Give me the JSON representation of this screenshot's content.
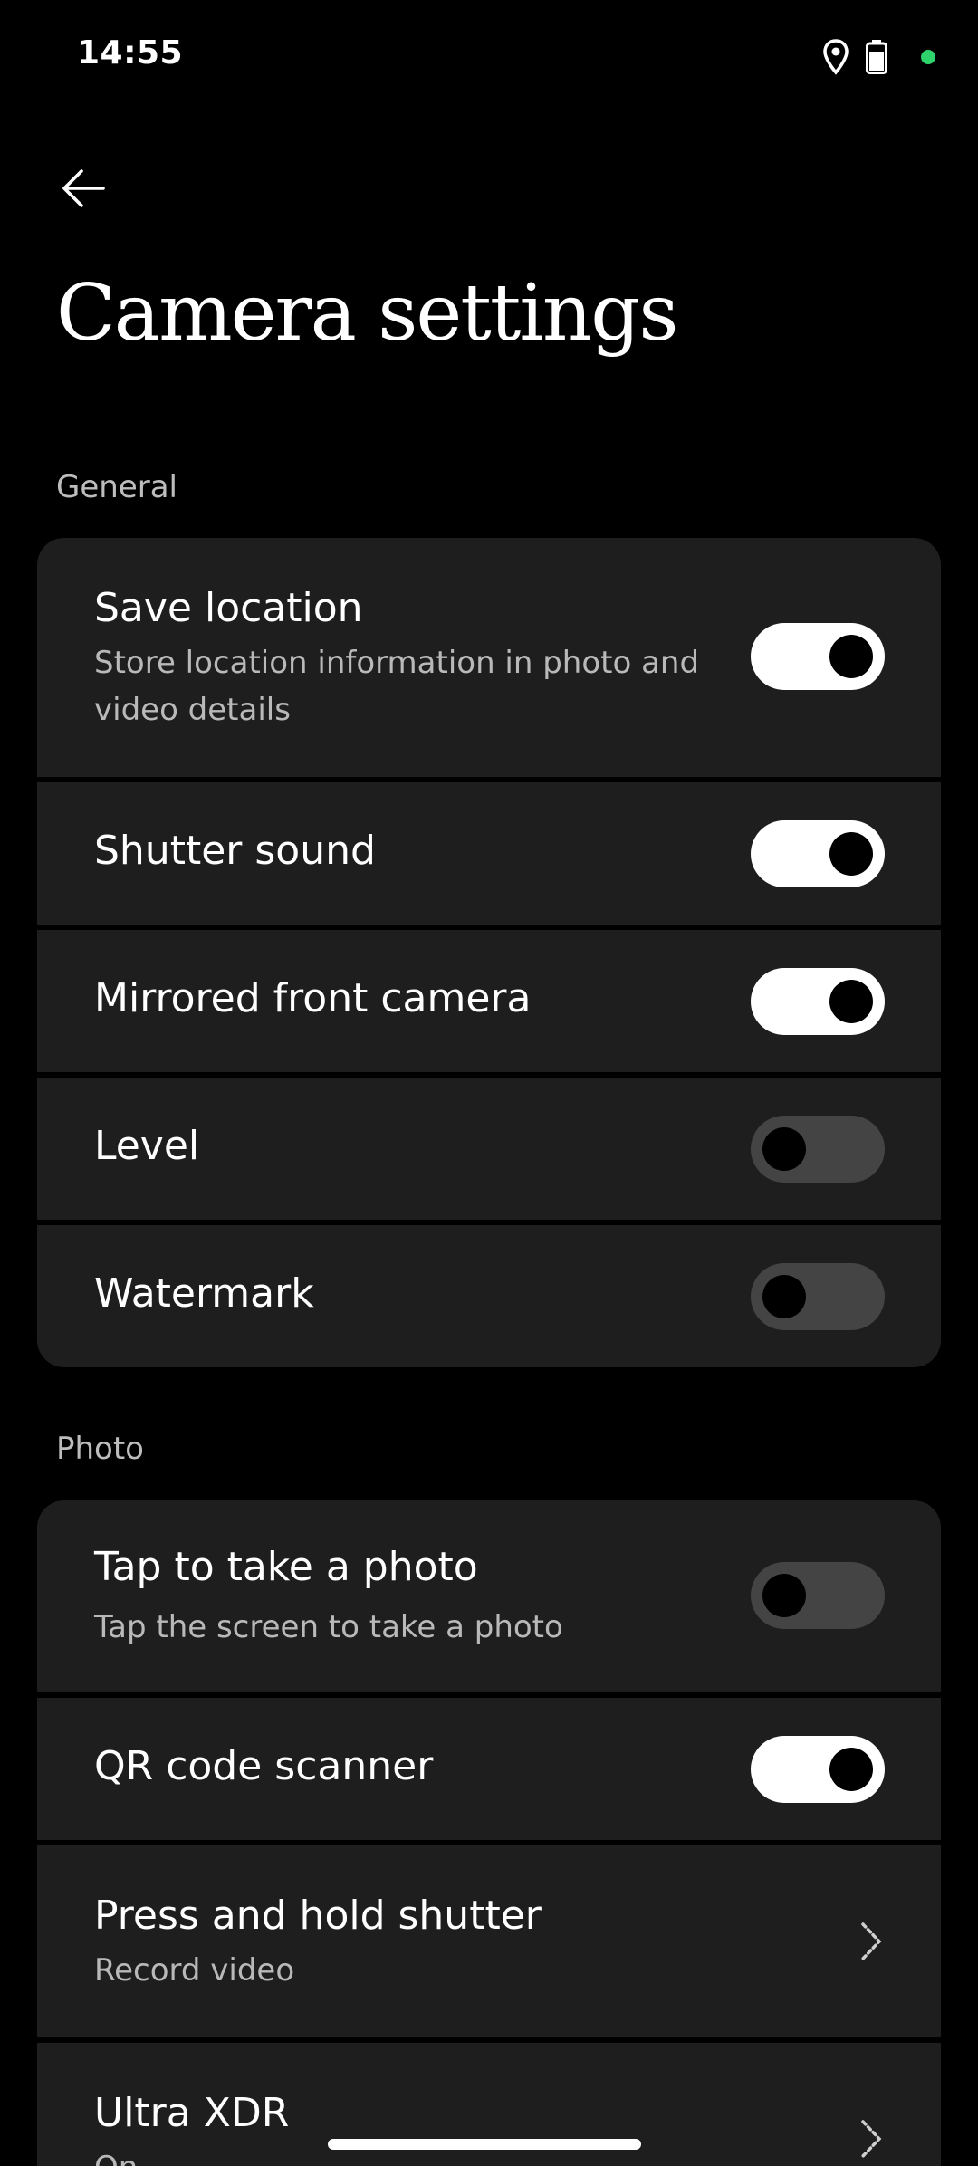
{
  "status_bar": {
    "time": "14:55",
    "icons": [
      "location-icon",
      "battery-icon",
      "privacy-dot-icon"
    ],
    "dot_color": "#2ed36b"
  },
  "header": {
    "back_icon": "arrow-left-icon",
    "title": "Camera settings"
  },
  "sections": {
    "general": {
      "label": "General",
      "items": [
        {
          "title": "Save location",
          "subtitle": "Store location information in photo and video details",
          "toggle": true
        },
        {
          "title": "Shutter sound",
          "toggle": true
        },
        {
          "title": "Mirrored front camera",
          "toggle": true
        },
        {
          "title": "Level",
          "toggle": false
        },
        {
          "title": "Watermark",
          "toggle": false
        }
      ]
    },
    "photo": {
      "label": "Photo",
      "items": [
        {
          "title": "Tap to take a photo",
          "subtitle": "Tap the screen to take a photo",
          "toggle": false
        },
        {
          "title": "QR code scanner",
          "toggle": true
        },
        {
          "title": "Press and hold shutter",
          "subtitle": "Record video",
          "control": "chevron-right-icon"
        },
        {
          "title": "Ultra XDR",
          "subtitle": "On",
          "control": "chevron-right-icon"
        }
      ]
    }
  },
  "colors": {
    "background": "#000000",
    "card": "#1e1e1e",
    "toggle_on": "#ffffff",
    "toggle_off": "#444444",
    "secondary_text": "#b9b9b9"
  }
}
